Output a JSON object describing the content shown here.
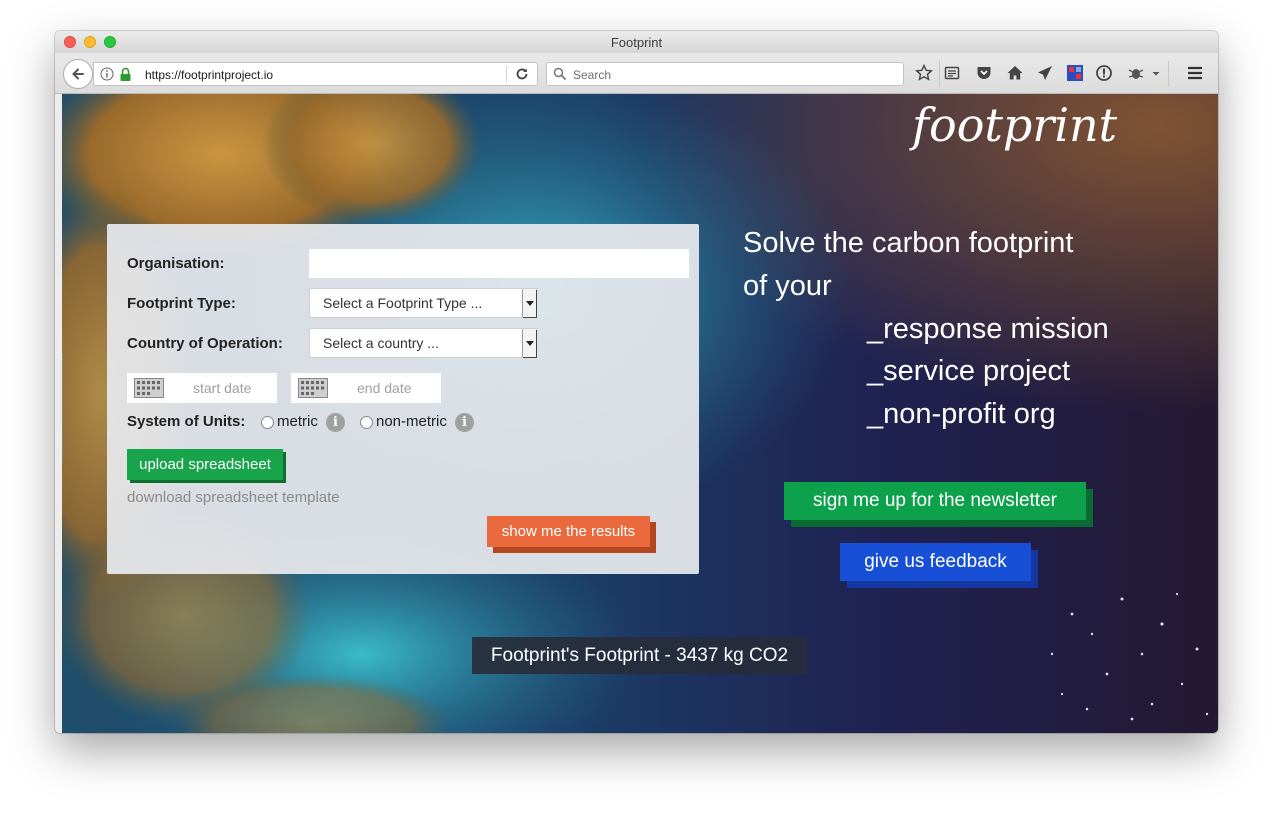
{
  "browser": {
    "window_title": "Footprint",
    "url": "https://footprintproject.io",
    "search_placeholder": "Search"
  },
  "site": {
    "logo_text": "footprint",
    "form": {
      "organisation_label": "Organisation:",
      "organisation_value": "",
      "footprint_type_label": "Footprint Type:",
      "footprint_type_selected": "Select a Footprint Type ...",
      "country_label": "Country of Operation:",
      "country_selected": "Select a country ...",
      "start_date_placeholder": "start date",
      "end_date_placeholder": "end date",
      "units_label": "System of Units:",
      "unit_metric": "metric",
      "unit_non_metric": "non-metric",
      "info_glyph": "i",
      "upload_button": "upload spreadsheet",
      "download_link": "download spreadsheet template",
      "results_button": "show me the results"
    },
    "tagline": {
      "line1": "Solve the carbon footprint",
      "line2": "of your",
      "items": [
        "_response mission",
        "_service project",
        "_non-profit org"
      ]
    },
    "newsletter_button": "sign me up for the newsletter",
    "feedback_button": "give us feedback",
    "footprint_note": "Footprint's Footprint - 3437 kg CO2"
  },
  "colors": {
    "green": "#17a44a",
    "orange": "#ea6a3e",
    "blue": "#1750d6"
  }
}
